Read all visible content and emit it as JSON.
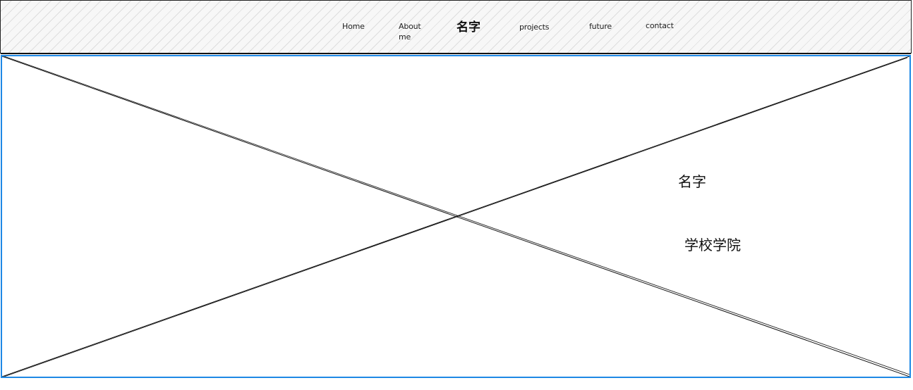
{
  "nav": {
    "items": [
      {
        "label": "Home"
      },
      {
        "label": "About me"
      },
      {
        "label": "projects"
      },
      {
        "label": "future"
      },
      {
        "label": "contact"
      }
    ],
    "brand": "名字"
  },
  "hero": {
    "name": "名字",
    "school": "学校学院"
  },
  "colors": {
    "selection_border": "#1e88e5",
    "sketch_line": "#111111"
  }
}
